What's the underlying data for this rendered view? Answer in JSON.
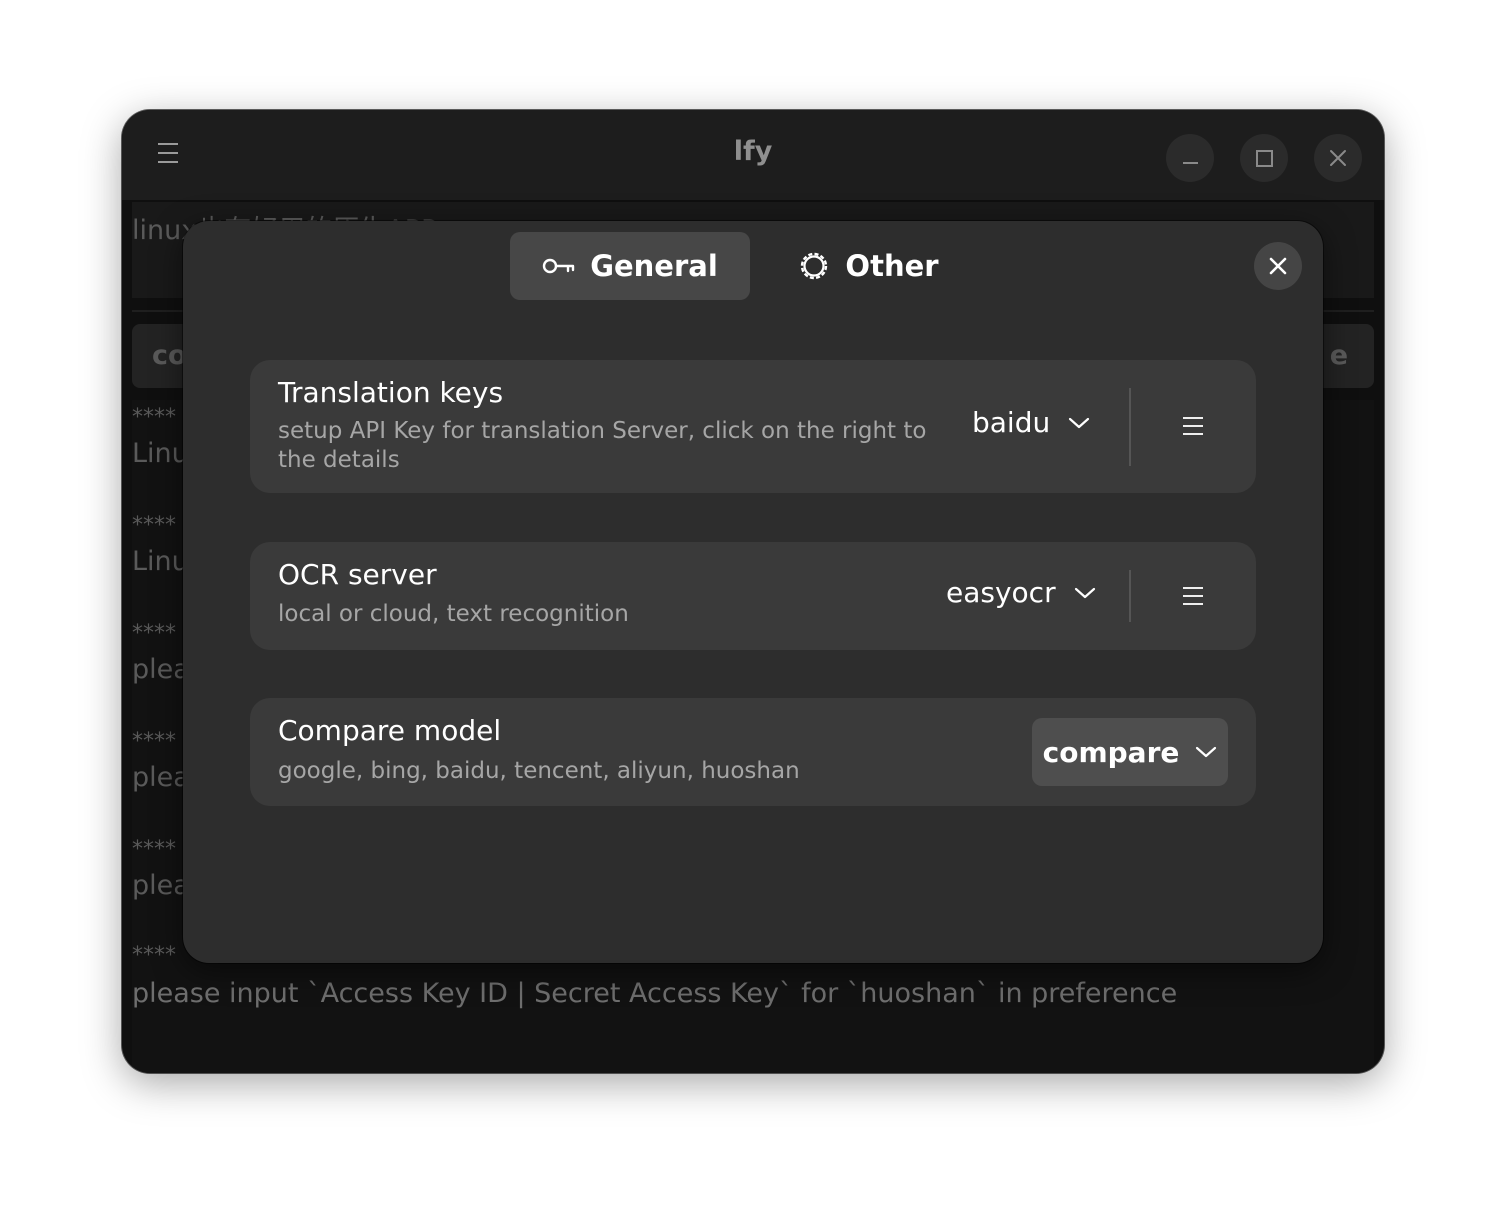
{
  "window": {
    "title": "lfy"
  },
  "input": {
    "text": "linux也有好用的原生APP"
  },
  "toolbar": {
    "left_label": "co",
    "right_label": "e"
  },
  "output": {
    "lines": [
      "****",
      "Linu",
      "****",
      "Linu",
      "****",
      "plea",
      "****",
      "plea",
      "****",
      "plea",
      "****    huoshan:0.003",
      "please input `Access Key ID | Secret Access Key` for `huoshan` in preference"
    ]
  },
  "dialog": {
    "tabs": [
      {
        "label": "General",
        "icon": "key-icon",
        "selected": true
      },
      {
        "label": "Other",
        "icon": "gear-icon",
        "selected": false
      }
    ],
    "rows": [
      {
        "title": "Translation keys",
        "subtitle": "setup API Key for translation Server, click on the right to the details",
        "value": "baidu"
      },
      {
        "title": "OCR server",
        "subtitle": "local or cloud, text recognition",
        "value": "easyocr"
      },
      {
        "title": "Compare model",
        "subtitle": "google, bing, baidu, tencent, aliyun, huoshan",
        "value": "compare"
      }
    ]
  },
  "colors": {
    "window_bg": "#0f0f0f",
    "header_bg": "#1d1d1d",
    "dialog_bg": "#2d2d2d",
    "row_bg": "#3a3a3a",
    "selected_tab_bg": "#474747"
  }
}
